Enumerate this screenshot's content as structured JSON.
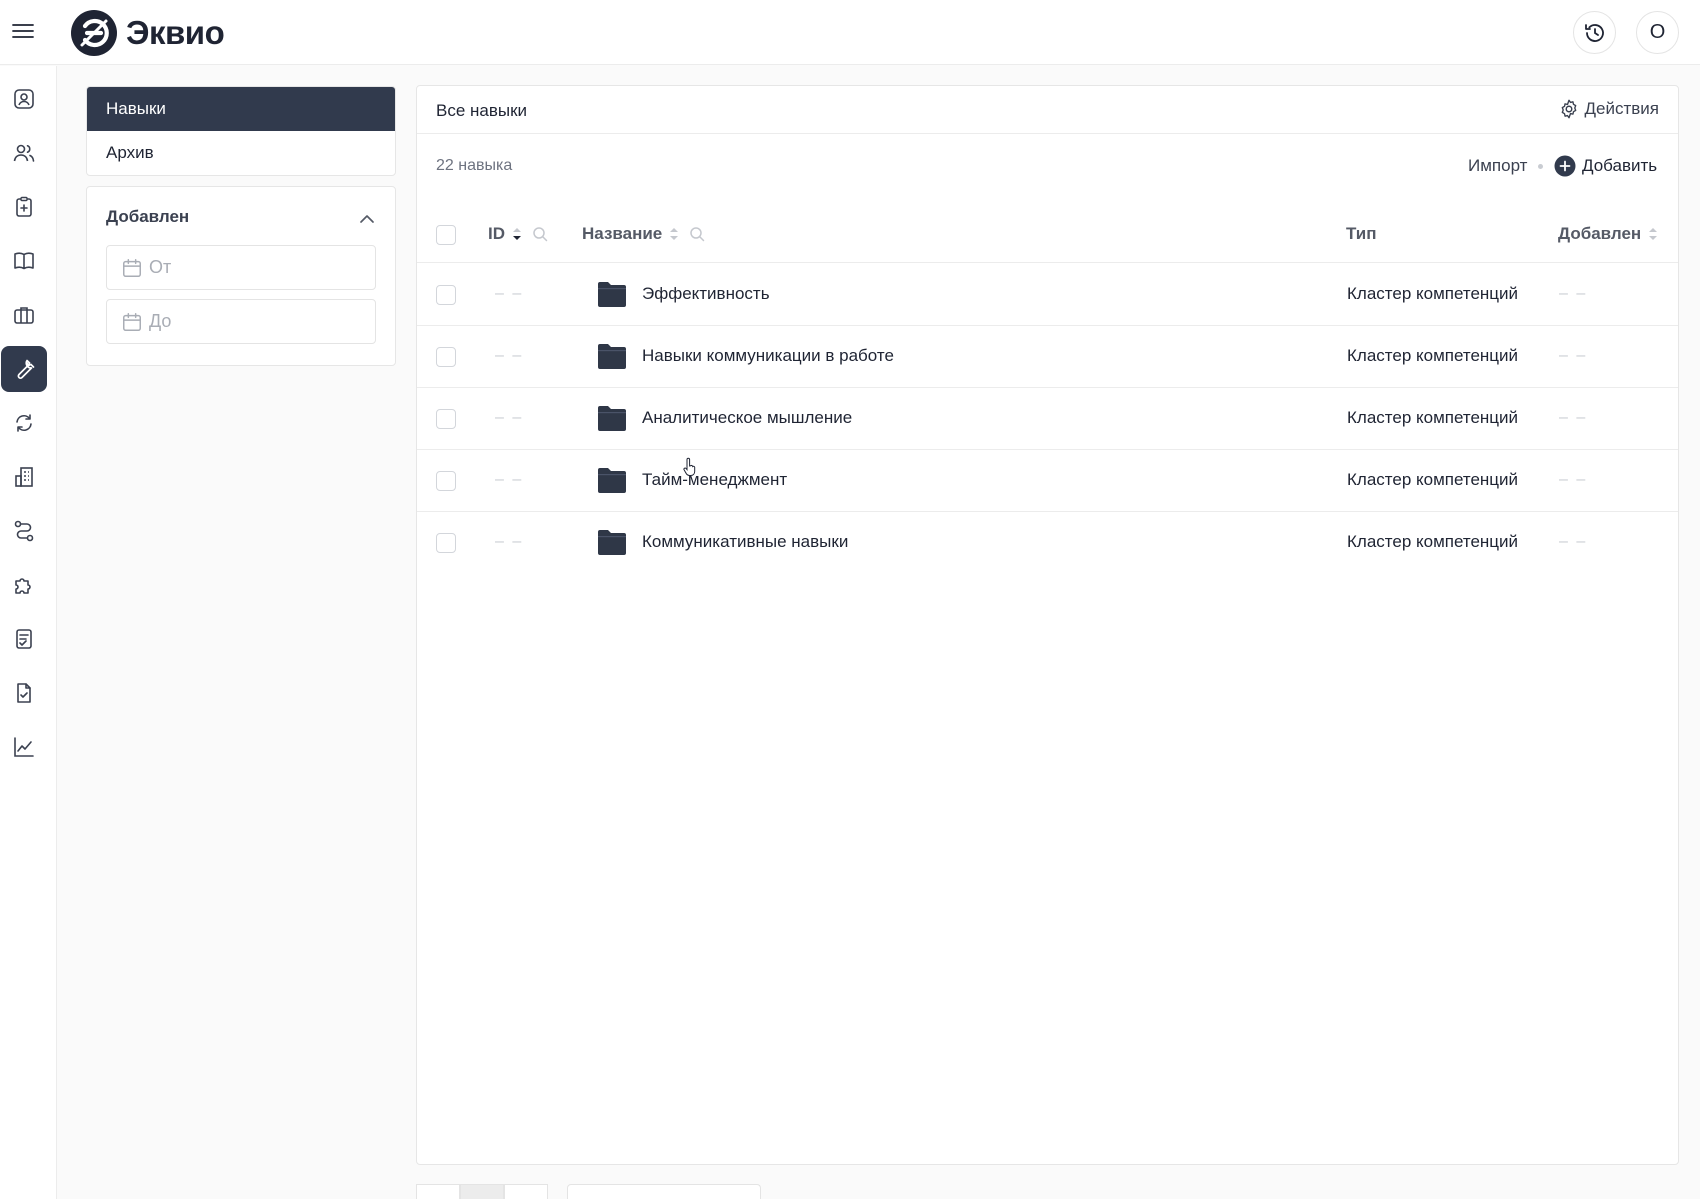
{
  "app": {
    "brand_name": "Эквио",
    "user_badge": "О"
  },
  "subnav": {
    "items": [
      {
        "label": "Навыки",
        "active": true
      },
      {
        "label": "Архив",
        "active": false
      }
    ]
  },
  "filter": {
    "title": "Добавлен",
    "from_placeholder": "От",
    "to_placeholder": "До"
  },
  "main": {
    "title": "Все навыки",
    "actions_label": "Действия",
    "count_text": "22 навыка",
    "import_label": "Импорт",
    "add_label": "Добавить"
  },
  "table": {
    "columns": {
      "id": "ID",
      "name": "Название",
      "type": "Тип",
      "added": "Добавлен"
    },
    "rows": [
      {
        "id": "– –",
        "name": "Эффективность",
        "type": "Кластер компетенций",
        "added": "– –"
      },
      {
        "id": "– –",
        "name": "Навыки коммуникации в работе",
        "type": "Кластер компетенций",
        "added": "– –"
      },
      {
        "id": "– –",
        "name": "Аналитическое мышление",
        "type": "Кластер компетенций",
        "added": "– –"
      },
      {
        "id": "– –",
        "name": "Тайм-менеджмент",
        "type": "Кластер компетенций",
        "added": "– –"
      },
      {
        "id": "– –",
        "name": "Коммуникативные навыки",
        "type": "Кластер компетенций",
        "added": "– –"
      }
    ]
  },
  "rail": {
    "icons": [
      "user-card-icon",
      "users-icon",
      "clipboard-plus-icon",
      "book-icon",
      "briefcase-icon",
      "wrench-icon",
      "refresh-icon",
      "building-icon",
      "route-icon",
      "puzzle-icon",
      "checklist-icon",
      "document-check-icon",
      "chart-line-icon"
    ],
    "active_icon": "wrench-icon"
  },
  "colors": {
    "accent": "#313a4d",
    "border": "#e6e6e6",
    "muted_text": "#6e7380"
  }
}
